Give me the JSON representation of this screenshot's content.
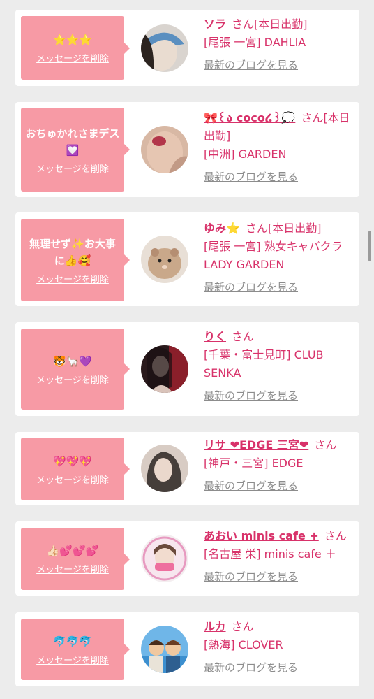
{
  "delete_label": "メッセージを削除",
  "blog_label": "最新のブログを見る",
  "san": "さん",
  "items": [
    {
      "message": "⭐⭐⭐",
      "name": "ソラ",
      "status": "[本日出勤]",
      "location": "[尾張 一宮] DAHLIA",
      "avatar_icon": "avatar-photo-icon"
    },
    {
      "message": "おちゅかれさまデス💟",
      "name": "🎀꒰ა coco໒꒱💭",
      "status": "[本日出勤]",
      "location": "[中洲] GARDEN",
      "avatar_icon": "avatar-photo-icon"
    },
    {
      "message": "無理せず✨お大事に👍🥰",
      "name": "ゆみ⭐",
      "status": "[本日出勤]",
      "location": "[尾張 一宮] 熟女キャバクラ LADY GARDEN",
      "avatar_icon": "hamster-icon"
    },
    {
      "message": "🐯🦙💜",
      "name": "りく",
      "status": "",
      "location": "[千葉・富士見町] CLUB SENKA",
      "avatar_icon": "avatar-photo-icon"
    },
    {
      "message": "💖💖💖",
      "name": "リサ ❤EDGE 三宮❤",
      "status": "",
      "location": "[神戸・三宮] EDGE",
      "avatar_icon": "avatar-photo-icon"
    },
    {
      "message": "👍🏻💕💕💕",
      "name": "あおい minis cafe +",
      "status": "",
      "location": "[名古屋 栄] minis cafe ＋",
      "avatar_icon": "avatar-photo-icon"
    },
    {
      "message": "🐬🐬🐬",
      "name": "ルカ",
      "status": "",
      "location": "[熱海] CLOVER",
      "avatar_icon": "avatar-illustration-icon"
    }
  ],
  "colors": {
    "accent": "#d8326a",
    "bubble": "#f79aa5",
    "background": "#ececec"
  }
}
